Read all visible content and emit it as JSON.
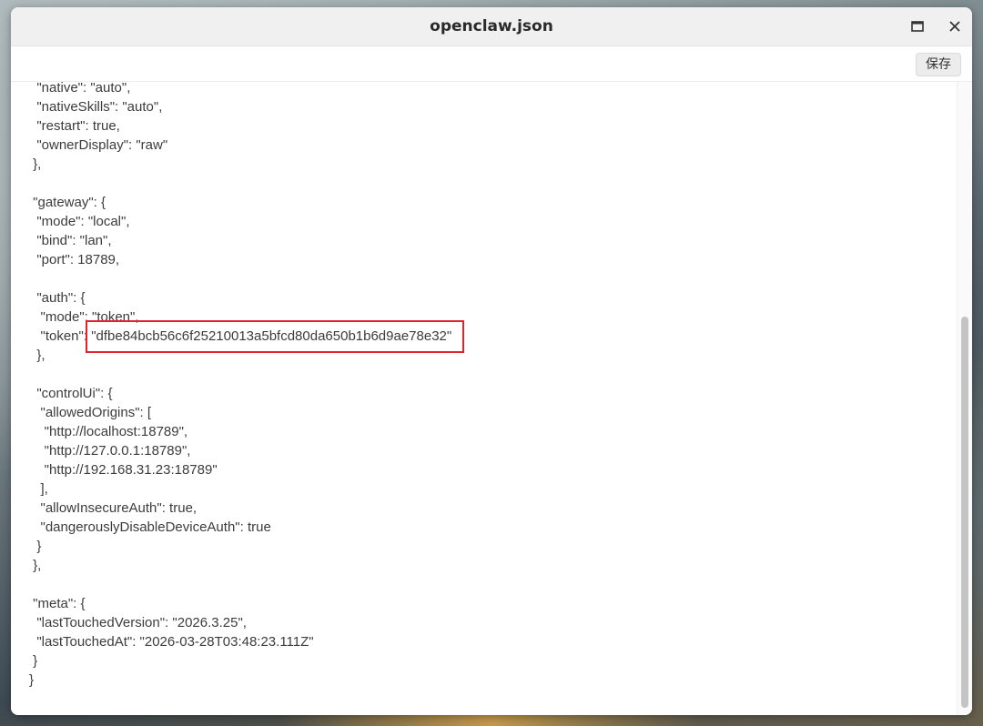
{
  "window": {
    "title": "openclaw.json"
  },
  "toolbar": {
    "save_label": "保存"
  },
  "icons": {
    "maximize": "maximize-icon",
    "close": "close-icon"
  },
  "editor": {
    "lines": [
      "  \"native\": \"auto\",",
      "  \"nativeSkills\": \"auto\",",
      "  \"restart\": true,",
      "  \"ownerDisplay\": \"raw\"",
      " },",
      "",
      " \"gateway\": {",
      "  \"mode\": \"local\",",
      "  \"bind\": \"lan\",",
      "  \"port\": 18789,",
      "",
      "  \"auth\": {",
      "   \"mode\": \"token\",",
      "   \"token\": ",
      "  },",
      "",
      "  \"controlUi\": {",
      "   \"allowedOrigins\": [",
      "    \"http://localhost:18789\",",
      "    \"http://127.0.0.1:18789\",",
      "    \"http://192.168.31.23:18789\"",
      "   ],",
      "   \"allowInsecureAuth\": true,",
      "   \"dangerouslyDisableDeviceAuth\": true",
      "  }",
      " },",
      "",
      " \"meta\": {",
      "  \"lastTouchedVersion\": \"2026.3.25\",",
      "  \"lastTouchedAt\": \"2026-03-28T03:48:23.111Z\"",
      " }",
      "}"
    ],
    "highlighted_token": "\"dfbe84bcb56c6f25210013a5bfcd80da650b1b6d9ae78e32\"",
    "highlight_color": "#e0242c"
  }
}
